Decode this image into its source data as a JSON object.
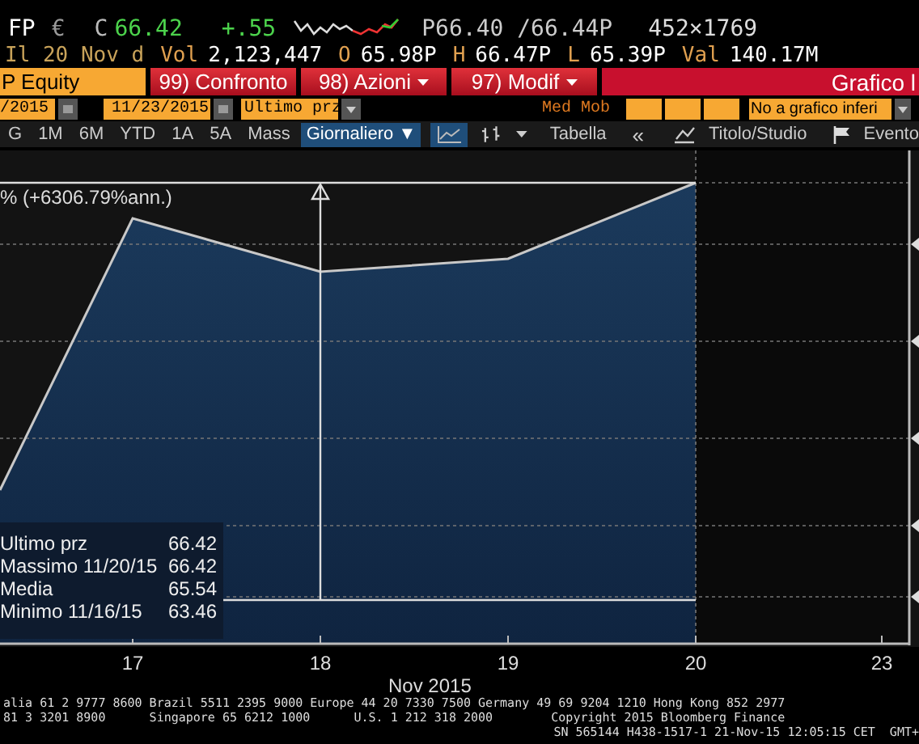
{
  "quote": {
    "ticker": "FP",
    "currency": "€",
    "last_label": "C",
    "last": "66.42",
    "change": "+.55",
    "bid_ask": "P66.40 /66.44P",
    "size": "452×1769"
  },
  "session": {
    "date": "Il 20 Nov d",
    "fields": [
      {
        "label": "Vol",
        "value": "2,123,447"
      },
      {
        "label": "O",
        "value": "65.98P"
      },
      {
        "label": "H",
        "value": "66.47P"
      },
      {
        "label": "L",
        "value": "65.39P"
      },
      {
        "label": "Val",
        "value": "140.17M"
      }
    ]
  },
  "command_bar": {
    "security": "P Equity",
    "buttons": [
      {
        "number": "99)",
        "label": "Confronto",
        "dropdown": false
      },
      {
        "number": "98)",
        "label": "Azioni",
        "dropdown": true
      },
      {
        "number": "97)",
        "label": "Modif",
        "dropdown": true
      }
    ],
    "title": "Grafico l"
  },
  "settings": {
    "start_date": "/2015",
    "end_date": "11/23/2015",
    "field": "Ultimo prz",
    "study_label": "Med Mob",
    "lower_chart": "No a grafico inferi"
  },
  "toolbar": {
    "periods": [
      {
        "label": "G",
        "selected": false
      },
      {
        "label": "1M",
        "selected": false
      },
      {
        "label": "6M",
        "selected": false
      },
      {
        "label": "YTD",
        "selected": false
      },
      {
        "label": "1A",
        "selected": false
      },
      {
        "label": "5A",
        "selected": false
      },
      {
        "label": "Mass",
        "selected": false
      }
    ],
    "frequency": "Giornaliero ▼",
    "table": "Tabella",
    "collapse": "«",
    "studies": "Titolo/Studio",
    "event": "Evento"
  },
  "chart": {
    "annotation": "% (+6306.79%ann.)",
    "legend": [
      {
        "label": "Ultimo prz",
        "value": "66.42"
      },
      {
        "label": "Massimo 11/20/15",
        "value": "66.42"
      },
      {
        "label": "Media",
        "value": "65.54"
      },
      {
        "label": "Minimo 11/16/15",
        "value": "63.46"
      }
    ],
    "x_labels": [
      "17",
      "18",
      "19",
      "20",
      "23"
    ],
    "xlabel": "Nov 2015"
  },
  "footer": [
    "alia 61 2 9777 8600 Brazil 5511 2395 9000 Europe 44 20 7330 7500 Germany 49 69 9204 1210 Hong Kong 852 2977",
    "81 3 3201 8900      Singapore 65 6212 1000      U.S. 1 212 318 2000        Copyright 2015 Bloomberg Finance",
    "SN 565144 H438-1517-1 21-Nov-15 12:05:15 CET  GMT+"
  ]
}
